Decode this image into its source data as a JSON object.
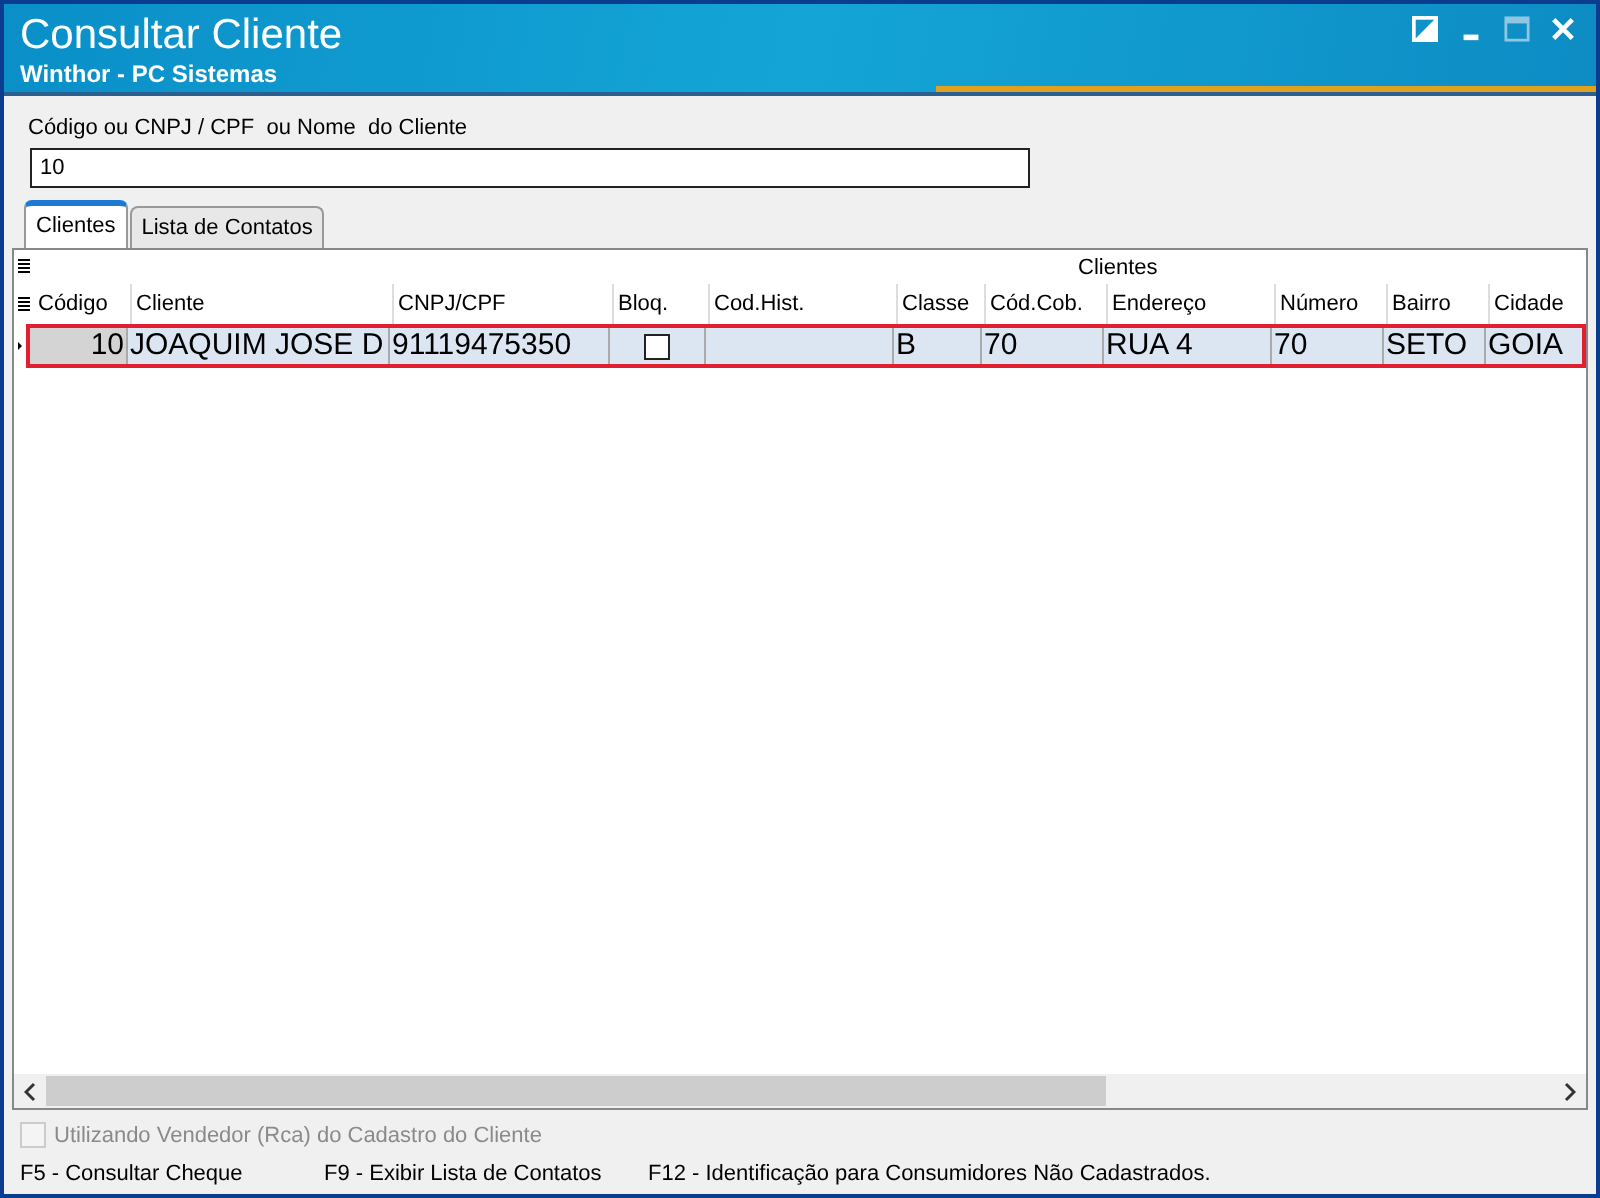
{
  "window": {
    "title": "Consultar Cliente",
    "subtitle": "Winthor - PC Sistemas"
  },
  "search": {
    "label": "Código ou CNPJ / CPF  ou Nome  do Cliente",
    "value": "10"
  },
  "tabs": [
    {
      "label": "Clientes",
      "selected": true
    },
    {
      "label": "Lista de Contatos",
      "selected": false
    }
  ],
  "grid": {
    "band": "Clientes",
    "columns": [
      {
        "label": "Código",
        "kind": "text"
      },
      {
        "label": "Cliente",
        "kind": "text"
      },
      {
        "label": "CNPJ/CPF",
        "kind": "text"
      },
      {
        "label": "Bloq.",
        "kind": "check"
      },
      {
        "label": "Cod.Hist.",
        "kind": "text"
      },
      {
        "label": "Classe",
        "kind": "text"
      },
      {
        "label": "Cód.Cob.",
        "kind": "text"
      },
      {
        "label": "Endereço",
        "kind": "text"
      },
      {
        "label": "Número",
        "kind": "text"
      },
      {
        "label": "Bairro",
        "kind": "text"
      },
      {
        "label": "Cidade",
        "kind": "text"
      }
    ],
    "rows": [
      {
        "selected": true,
        "cells": [
          "10",
          "JOAQUIM JOSE D",
          "91119475350",
          false,
          "",
          "B",
          "70",
          "RUA 4",
          "70",
          "SETO",
          "GOIA"
        ]
      }
    ]
  },
  "option": {
    "label": "Utilizando Vendedor (Rca) do Cadastro do Cliente",
    "checked": false,
    "disabled": true
  },
  "shortcuts": [
    "F5 - Consultar Cheque",
    "F9 - Exibir Lista de Contatos",
    "F12 - Identificação para Consumidores Não Cadastrados."
  ]
}
